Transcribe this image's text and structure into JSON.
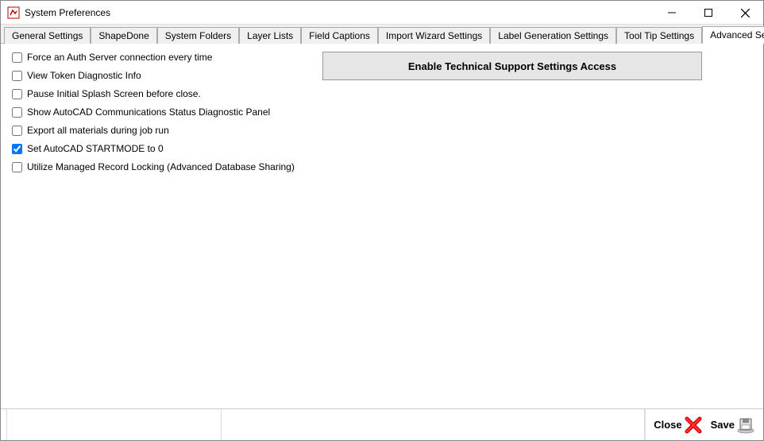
{
  "window": {
    "title": "System Preferences"
  },
  "tabs": [
    {
      "label": "General Settings"
    },
    {
      "label": "ShapeDone"
    },
    {
      "label": "System Folders"
    },
    {
      "label": "Layer Lists"
    },
    {
      "label": "Field Captions"
    },
    {
      "label": "Import Wizard Settings"
    },
    {
      "label": "Label Generation Settings"
    },
    {
      "label": "Tool Tip Settings"
    },
    {
      "label": "Advanced Settings"
    }
  ],
  "activeTabIndex": 8,
  "checks": [
    {
      "label": "Force an Auth Server connection every time",
      "checked": false
    },
    {
      "label": "View Token Diagnostic Info",
      "checked": false
    },
    {
      "label": "Pause Initial Splash Screen before close.",
      "checked": false
    },
    {
      "label": "Show AutoCAD Communications Status Diagnostic Panel",
      "checked": false
    },
    {
      "label": "Export all materials during job run",
      "checked": false
    },
    {
      "label": "Set AutoCAD STARTMODE to 0",
      "checked": true
    },
    {
      "label": "Utilize Managed Record Locking (Advanced Database Sharing)",
      "checked": false
    }
  ],
  "bigButton": {
    "label": "Enable Technical Support Settings Access"
  },
  "footer": {
    "close": "Close",
    "save": "Save"
  }
}
